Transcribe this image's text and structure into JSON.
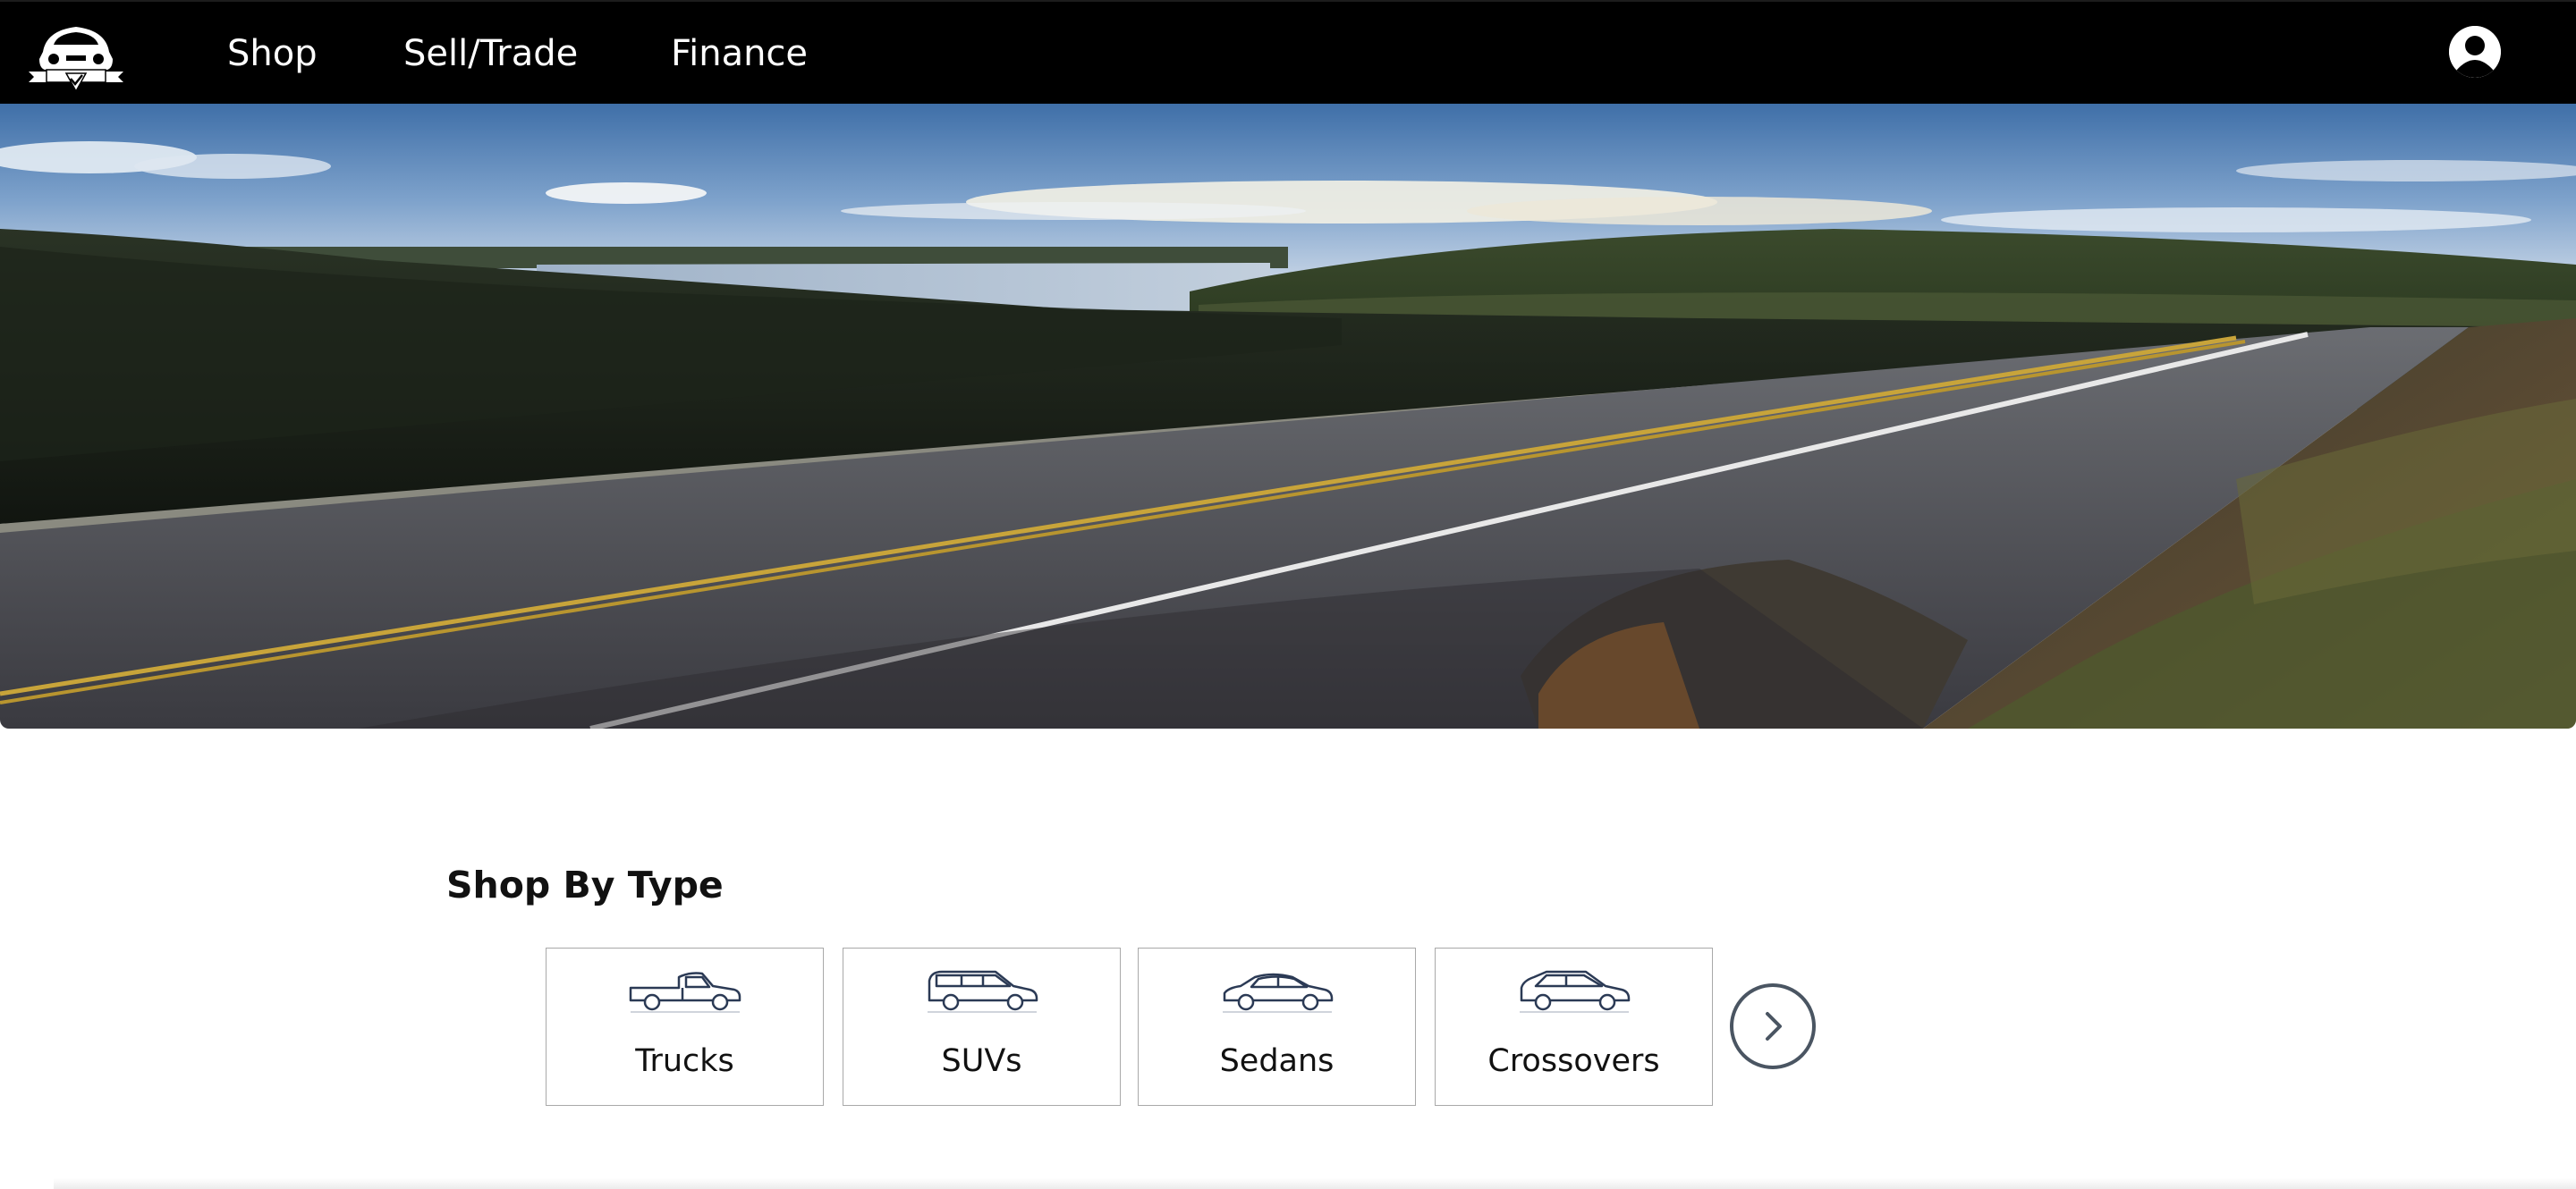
{
  "navbar": {
    "links": [
      {
        "label": "Shop"
      },
      {
        "label": "Sell/Trade"
      },
      {
        "label": "Finance"
      }
    ],
    "logo_icon": "car-badge-logo-icon",
    "account_icon": "user-avatar-icon",
    "background": "#000000"
  },
  "hero": {
    "image": "scenic-highway-lake-landscape"
  },
  "shop_by_type": {
    "title": "Shop By Type",
    "types": [
      {
        "label": "Trucks",
        "icon": "truck-icon"
      },
      {
        "label": "SUVs",
        "icon": "suv-icon"
      },
      {
        "label": "Sedans",
        "icon": "sedan-icon"
      },
      {
        "label": "Crossovers",
        "icon": "crossover-icon"
      }
    ],
    "next_icon": "chevron-right-icon",
    "icon_color": "#2b3a55"
  }
}
